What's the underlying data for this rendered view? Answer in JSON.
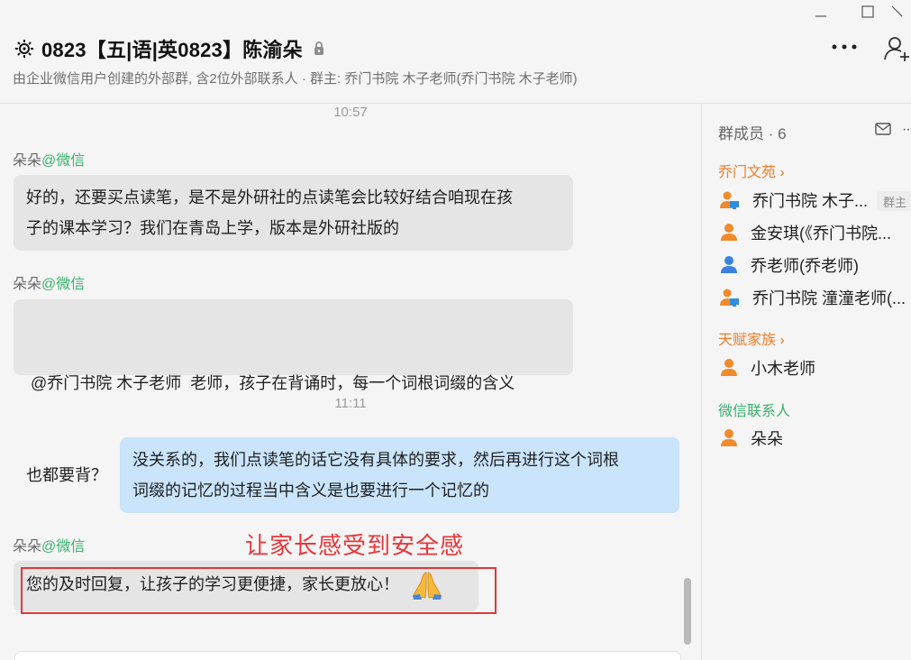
{
  "header": {
    "title": "0823【五|语|英0823】陈渝朵",
    "subtitle": "由企业微信用户创建的外部群, 含2位外部联系人 · 群主: 乔门书院 木子老师(乔门书院 木子老师)"
  },
  "chat": {
    "messages": [
      {
        "time": "10:57"
      },
      {
        "sender": "朵朵",
        "source": "@微信",
        "text_line1": "好的，还要买点读笔，是不是外研社的点读笔会比较好结合咱现在孩",
        "text_line2": "子的课本学习？我们在青岛上学，版本是外研社版的"
      },
      {
        "sender": "朵朵",
        "source": "@微信",
        "text_line1": " @乔门书院 木子老师  老师，孩子在背诵时，每一个词根词缀的含义",
        "text_line2": "也都要背？"
      },
      {
        "time": "11:11"
      },
      {
        "self": true,
        "text_line1": "没关系的，我们点读笔的话它没有具体的要求，然后再进行这个词根",
        "text_line2": "词缀的记忆的过程当中含义是也要进行一个记忆的"
      },
      {
        "sender": "朵朵",
        "source": "@微信",
        "text": "您的及时回复，让孩子的学习更便捷，家长更放心！"
      }
    ],
    "annotation": "让家长感受到安全感"
  },
  "sidebar": {
    "header": "群成员 · 6",
    "groups": [
      {
        "name": "乔门文苑 ›",
        "members": [
          {
            "name": "乔门书院 木子...",
            "badge": "群主"
          },
          {
            "name": "金安琪(《乔门书院..."
          },
          {
            "name": "乔老师(乔老师)"
          },
          {
            "name": "乔门书院 潼潼老师(..."
          }
        ]
      },
      {
        "name": "天赋家族 ›",
        "members": [
          {
            "name": "小木老师"
          }
        ]
      },
      {
        "name": "微信联系人",
        "members": [
          {
            "name": "朵朵"
          }
        ]
      }
    ]
  },
  "colors": {
    "accent_orange": "#f07d26",
    "wechat_green": "#37b26b",
    "annotation_red": "#e8353a",
    "self_bubble": "#c9e4fb",
    "other_bubble": "#e5e5e5"
  },
  "icons": [
    "minimize-icon",
    "maximize-icon",
    "close-icon",
    "group-gear-icon",
    "lock-icon",
    "more-icon",
    "add-member-icon",
    "mail-icon",
    "person-icon",
    "person-monitor-icon",
    "pray-emoji-icon"
  ]
}
